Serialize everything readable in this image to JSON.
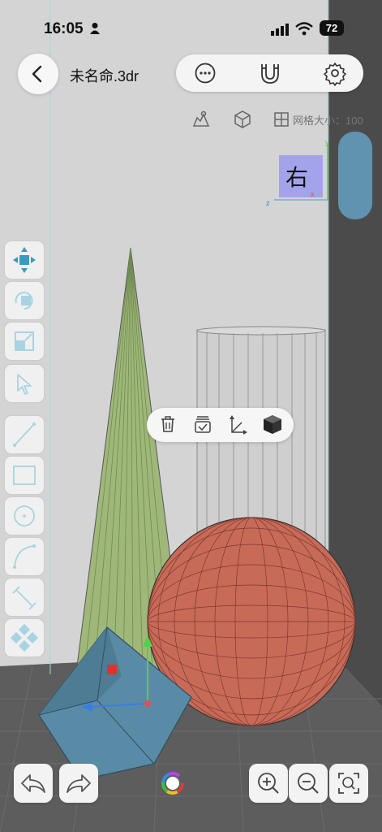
{
  "status_bar": {
    "time": "16:05",
    "battery": "72"
  },
  "header": {
    "file_name": "未名命.3dr"
  },
  "subheader": {
    "grid_label": "网格大小：100"
  },
  "view_cube": {
    "face_label": "右",
    "axis_x": "x",
    "axis_y": "y",
    "axis_z": "z"
  },
  "left_toolbar": [
    "move",
    "rotate",
    "scale",
    "select",
    "line",
    "rectangle",
    "circle",
    "arc",
    "dimension",
    "component"
  ],
  "context_menu": [
    "delete",
    "group",
    "transform",
    "material"
  ],
  "bottom_toolbar": [
    "undo",
    "redo",
    "color",
    "zoom-in",
    "zoom-out",
    "zoom-fit"
  ],
  "colors": {
    "cone": "#9fb87a",
    "sphere": "#c86a58",
    "cube": "#5a8ba6",
    "panel": "#4a4a4a",
    "accent": "#3aa0c8"
  }
}
